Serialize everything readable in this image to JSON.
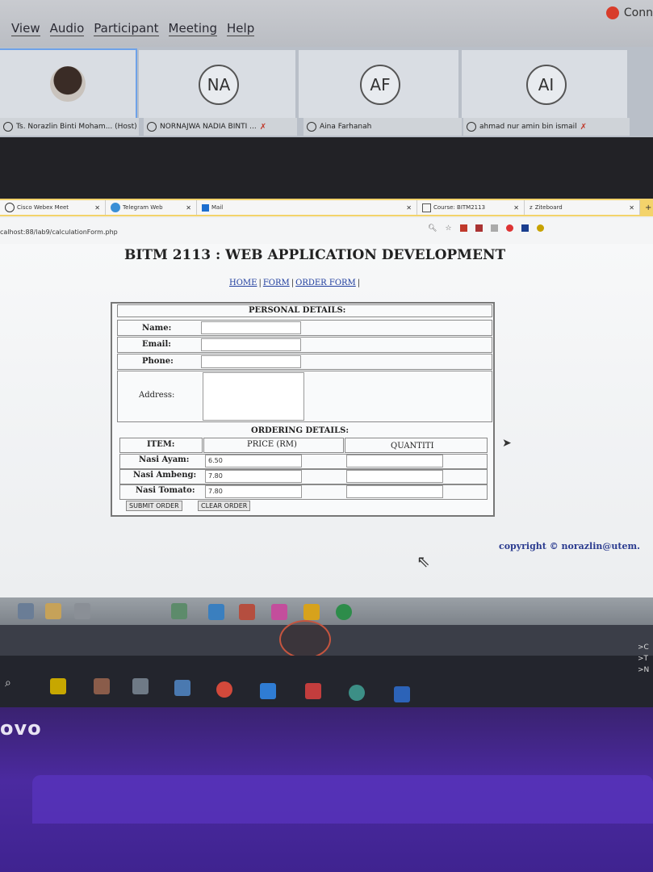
{
  "webex": {
    "menu": [
      "View",
      "Audio",
      "Participant",
      "Meeting",
      "Help"
    ],
    "connect_label": "Conn",
    "participants": [
      {
        "initials": "",
        "name": "Ts. Norazlin Binti Moham... (Host)"
      },
      {
        "initials": "NA",
        "name": "NORNAJWA NADIA BINTI ..."
      },
      {
        "initials": "AF",
        "name": "Aina Farhanah"
      },
      {
        "initials": "AI",
        "name": "ahmad nur amin bin ismail"
      }
    ]
  },
  "browser": {
    "tabs": [
      {
        "label": "Cisco Webex Meet"
      },
      {
        "label": "Telegram Web"
      },
      {
        "label": "Mail"
      },
      {
        "label": "Course: BITM2113"
      },
      {
        "label": "Ziteboard"
      }
    ],
    "new_tab": "+",
    "url": "calhost:88/lab9/calculationForm.php"
  },
  "page": {
    "title": "BITM 2113 : WEB APPLICATION DEVELOPMENT",
    "nav": [
      "HOME",
      "FORM",
      "ORDER FORM"
    ],
    "personal_header": "PERSONAL DETAILS:",
    "labels": {
      "name": "Name:",
      "email": "Email:",
      "phone": "Phone:",
      "address": "Address:"
    },
    "ordering_header": "ORDERING DETAILS:",
    "columns": [
      "ITEM:",
      "PRICE (RM)",
      "QUANTITI"
    ],
    "items": [
      {
        "name": "Nasi Ayam:",
        "price": "6.50"
      },
      {
        "name": "Nasi Ambeng:",
        "price": "7.80"
      },
      {
        "name": "Nasi Tomato:",
        "price": "7.80"
      }
    ],
    "submit": "SUBMIT ORDER",
    "clear": "CLEAR ORDER",
    "copyright": "copyright © norazlin@utem."
  },
  "laptop": {
    "brand": "ovo",
    "side_items": [
      ">C",
      ">T",
      ">N"
    ]
  }
}
